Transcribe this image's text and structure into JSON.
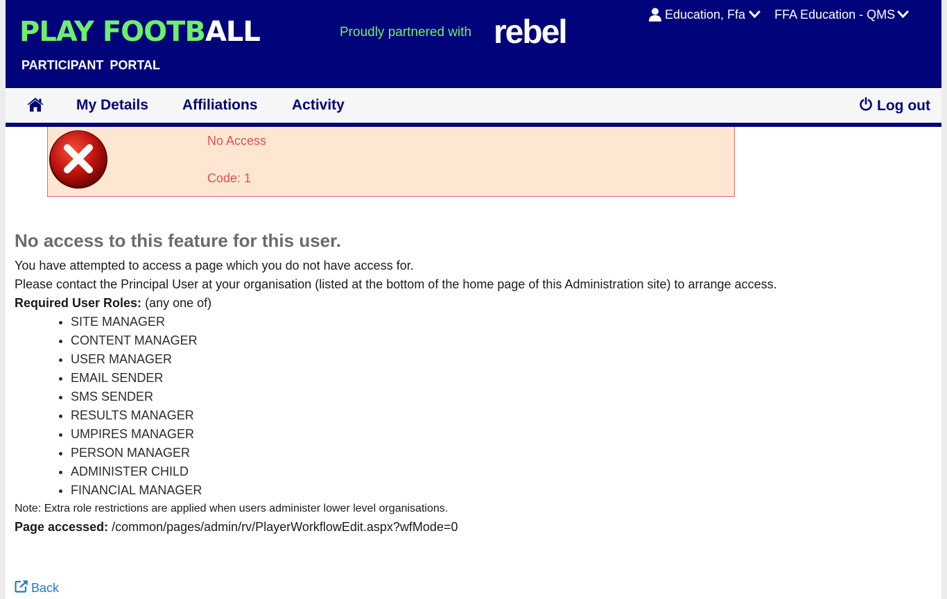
{
  "header": {
    "logo_green": "PLAY FOOTB",
    "logo_white": "ALL",
    "portal_label": "PARTICIPANT  PORTAL",
    "partner_text": "Proudly partnered with",
    "partner_brand": "rebel",
    "user_menu_label": "Education, Ffa",
    "org_menu_label": "FFA Education - QMS",
    "icons": {
      "user": "user-icon",
      "chevron": "chevron-down-icon"
    }
  },
  "nav": {
    "home_icon": "home-icon",
    "items": [
      {
        "label": "My Details"
      },
      {
        "label": "Affiliations"
      },
      {
        "label": "Activity"
      }
    ],
    "logout_label": "Log out",
    "logout_icon": "power-icon"
  },
  "alert": {
    "title": "No Access",
    "code": "Code: 1",
    "icon": "error-icon"
  },
  "main": {
    "heading": "No access to this feature for this user.",
    "line1": "You have attempted to access a page which you do not have access for.",
    "line2": "Please contact the Principal User at your organisation (listed at the bottom of the home page of this Administration site) to arrange access.",
    "roles_label": "Required User Roles:",
    "roles_qualifier": " (any one of)",
    "roles": [
      "SITE MANAGER",
      "CONTENT MANAGER",
      "USER MANAGER",
      "EMAIL SENDER",
      "SMS SENDER",
      "RESULTS MANAGER",
      "UMPIRES MANAGER",
      "PERSON MANAGER",
      "ADMINISTER CHILD",
      "FINANCIAL MANAGER"
    ],
    "note": "Note: Extra role restrictions are applied when users administer lower level organisations.",
    "accessed_label": "Page accessed:",
    "accessed_value": " /common/pages/admin/rv/PlayerWorkflowEdit.aspx?wfMode=0",
    "back_label": "Back",
    "back_icon": "external-link-icon"
  },
  "colors": {
    "brand_navy": "#00037a",
    "logo_green": "#6cf06a",
    "alert_bg": "#fde7d2",
    "alert_text": "#e0505a",
    "link_blue": "#1f7bd1"
  }
}
